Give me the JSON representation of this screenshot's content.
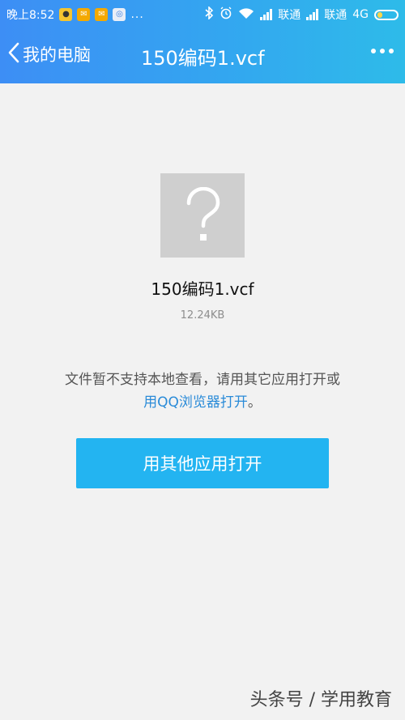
{
  "status_bar": {
    "time": "晚上8:52",
    "overflow": "...",
    "carrier1": "联通",
    "carrier2": "联通",
    "network": "4G"
  },
  "header": {
    "back_label": "我的电脑",
    "title": "150编码1.vcf"
  },
  "file": {
    "icon": "question-mark-icon",
    "name": "150编码1.vcf",
    "size": "12.24KB"
  },
  "message": {
    "line1": "文件暂不支持本地查看，请用其它应用打开或",
    "link": "用QQ浏览器打开",
    "suffix": "。"
  },
  "actions": {
    "open_other_app": "用其他应用打开"
  },
  "watermark": "头条号 / 学用教育",
  "colors": {
    "header_start": "#3d8ef5",
    "header_end": "#2ebbe9",
    "button": "#23b4f1",
    "link": "#2a8bd8",
    "background": "#f2f2f2"
  }
}
